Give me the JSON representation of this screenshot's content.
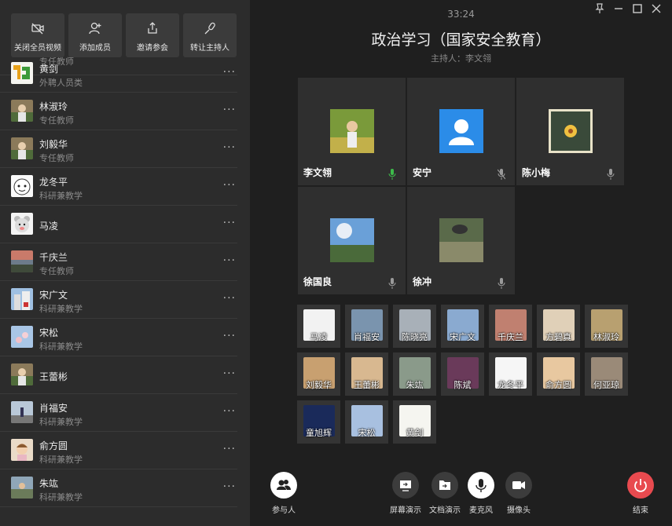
{
  "toolbar": {
    "buttons": [
      {
        "label": "关闭全员视频",
        "icon": "video-off-icon"
      },
      {
        "label": "添加成员",
        "icon": "add-user-icon"
      },
      {
        "label": "邀请参会",
        "icon": "share-icon"
      },
      {
        "label": "转让主持人",
        "icon": "transfer-host-icon"
      }
    ]
  },
  "participants": {
    "partial_top_role": "专任教师",
    "items": [
      {
        "name": "黄剑",
        "role": "外聘人员类",
        "avatar": "logo-avatar"
      },
      {
        "name": "林淑玲",
        "role": "专任教师",
        "avatar": "photo-avatar"
      },
      {
        "name": "刘毅华",
        "role": "专任教师",
        "avatar": "photo-avatar"
      },
      {
        "name": "龙冬平",
        "role": "科研兼教学",
        "avatar": "cartoon-avatar"
      },
      {
        "name": "马凌",
        "role": "",
        "avatar": "bear-avatar"
      },
      {
        "name": "千庆兰",
        "role": "专任教师",
        "avatar": "landscape-avatar"
      },
      {
        "name": "宋广文",
        "role": "科研兼教学",
        "avatar": "building-avatar"
      },
      {
        "name": "宋松",
        "role": "科研兼教学",
        "avatar": "flower-avatar"
      },
      {
        "name": "王蕾彬",
        "role": "",
        "avatar": "photo-avatar"
      },
      {
        "name": "肖福安",
        "role": "科研兼教学",
        "avatar": "street-avatar"
      },
      {
        "name": "俞方圆",
        "role": "科研兼教学",
        "avatar": "child-avatar"
      },
      {
        "name": "朱竑",
        "role": "科研兼教学",
        "avatar": "outdoor-avatar"
      }
    ],
    "more_label": "···"
  },
  "meeting": {
    "timer": "33:24",
    "title": "政治学习（国家安全教育）",
    "host": "主持人：李文翎"
  },
  "video_tiles": [
    {
      "name": "李文翎",
      "mic": "active"
    },
    {
      "name": "安宁",
      "mic": "muted"
    },
    {
      "name": "陈小梅",
      "mic": "idle"
    },
    {
      "name": "徐国良",
      "mic": "idle"
    },
    {
      "name": "徐冲",
      "mic": "idle"
    }
  ],
  "thumbnails": [
    "马凌",
    "肖福安",
    "陈晓亮",
    "宋广文",
    "千庆兰",
    "方碧真",
    "林淑玲",
    "刘毅华",
    "王蕾彬",
    "朱竑",
    "陈斌",
    "龙冬平",
    "俞方圆",
    "何亚琼",
    "童旭辉",
    "宋松",
    "黄剑"
  ],
  "bottom_bar": {
    "participants": "参与人",
    "screen_share": "屏幕演示",
    "doc_share": "文档演示",
    "mic": "麦克风",
    "camera": "摄像头",
    "end": "结束"
  },
  "colors": {
    "end_button": "#e84a4f",
    "mic_active": "#3dbb4a",
    "default_avatar": "#2b8ce8"
  }
}
